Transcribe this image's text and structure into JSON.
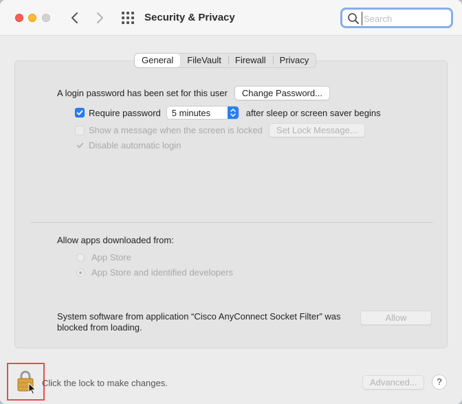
{
  "titlebar": {
    "title": "Security & Privacy",
    "search_placeholder": "Search"
  },
  "tabs": [
    {
      "label": "General",
      "active": true
    },
    {
      "label": "FileVault",
      "active": false
    },
    {
      "label": "Firewall",
      "active": false
    },
    {
      "label": "Privacy",
      "active": false
    }
  ],
  "general": {
    "login_password_text": "A login password has been set for this user",
    "change_password_label": "Change Password...",
    "require_password_label": "Require password",
    "require_password_checked": true,
    "require_password_delay": "5 minutes",
    "after_sleep_text": "after sleep or screen saver begins",
    "show_message_label": "Show a message when the screen is locked",
    "set_lock_message_label": "Set Lock Message...",
    "disable_auto_login_label": "Disable automatic login"
  },
  "allow_apps": {
    "heading": "Allow apps downloaded from:",
    "options": [
      {
        "label": "App Store",
        "selected": false
      },
      {
        "label": "App Store and identified developers",
        "selected": true
      }
    ]
  },
  "blocked": {
    "text": "System software from application “Cisco AnyConnect Socket Filter” was blocked from loading.",
    "allow_label": "Allow"
  },
  "footer": {
    "lock_text": "Click the lock to make changes.",
    "advanced_label": "Advanced...",
    "help_label": "?"
  },
  "colors": {
    "accent": "#2a7ef4",
    "highlight_box": "#e0504f"
  }
}
